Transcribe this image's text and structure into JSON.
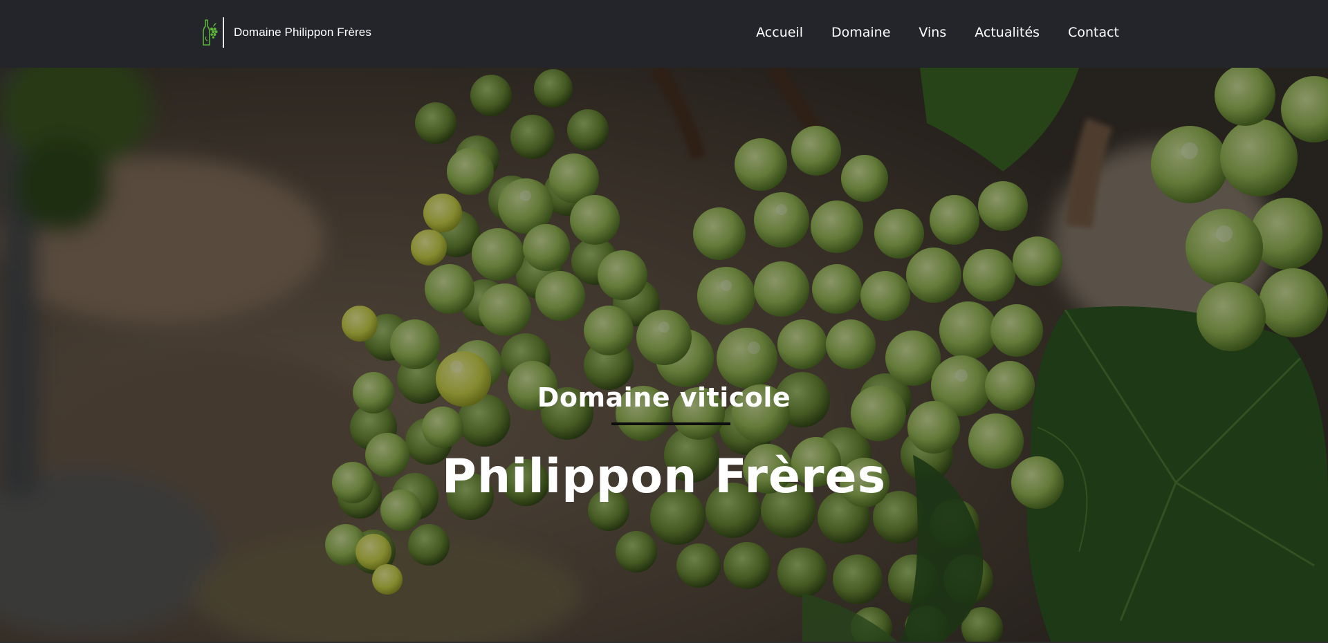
{
  "header": {
    "brand_name": "Domaine Philippon Frères",
    "logo_icon": "wine-bottle-grapes-icon"
  },
  "nav": {
    "items": [
      {
        "label": "Accueil"
      },
      {
        "label": "Domaine"
      },
      {
        "label": "Vins"
      },
      {
        "label": "Actualités"
      },
      {
        "label": "Contact"
      }
    ]
  },
  "hero": {
    "subtitle": "Domaine viticole",
    "title": "Philippon Frères"
  },
  "colors": {
    "header_bg": "#23252b",
    "text": "#ffffff",
    "logo_green": "#5bb33a",
    "rule": "#0d0d0d"
  }
}
